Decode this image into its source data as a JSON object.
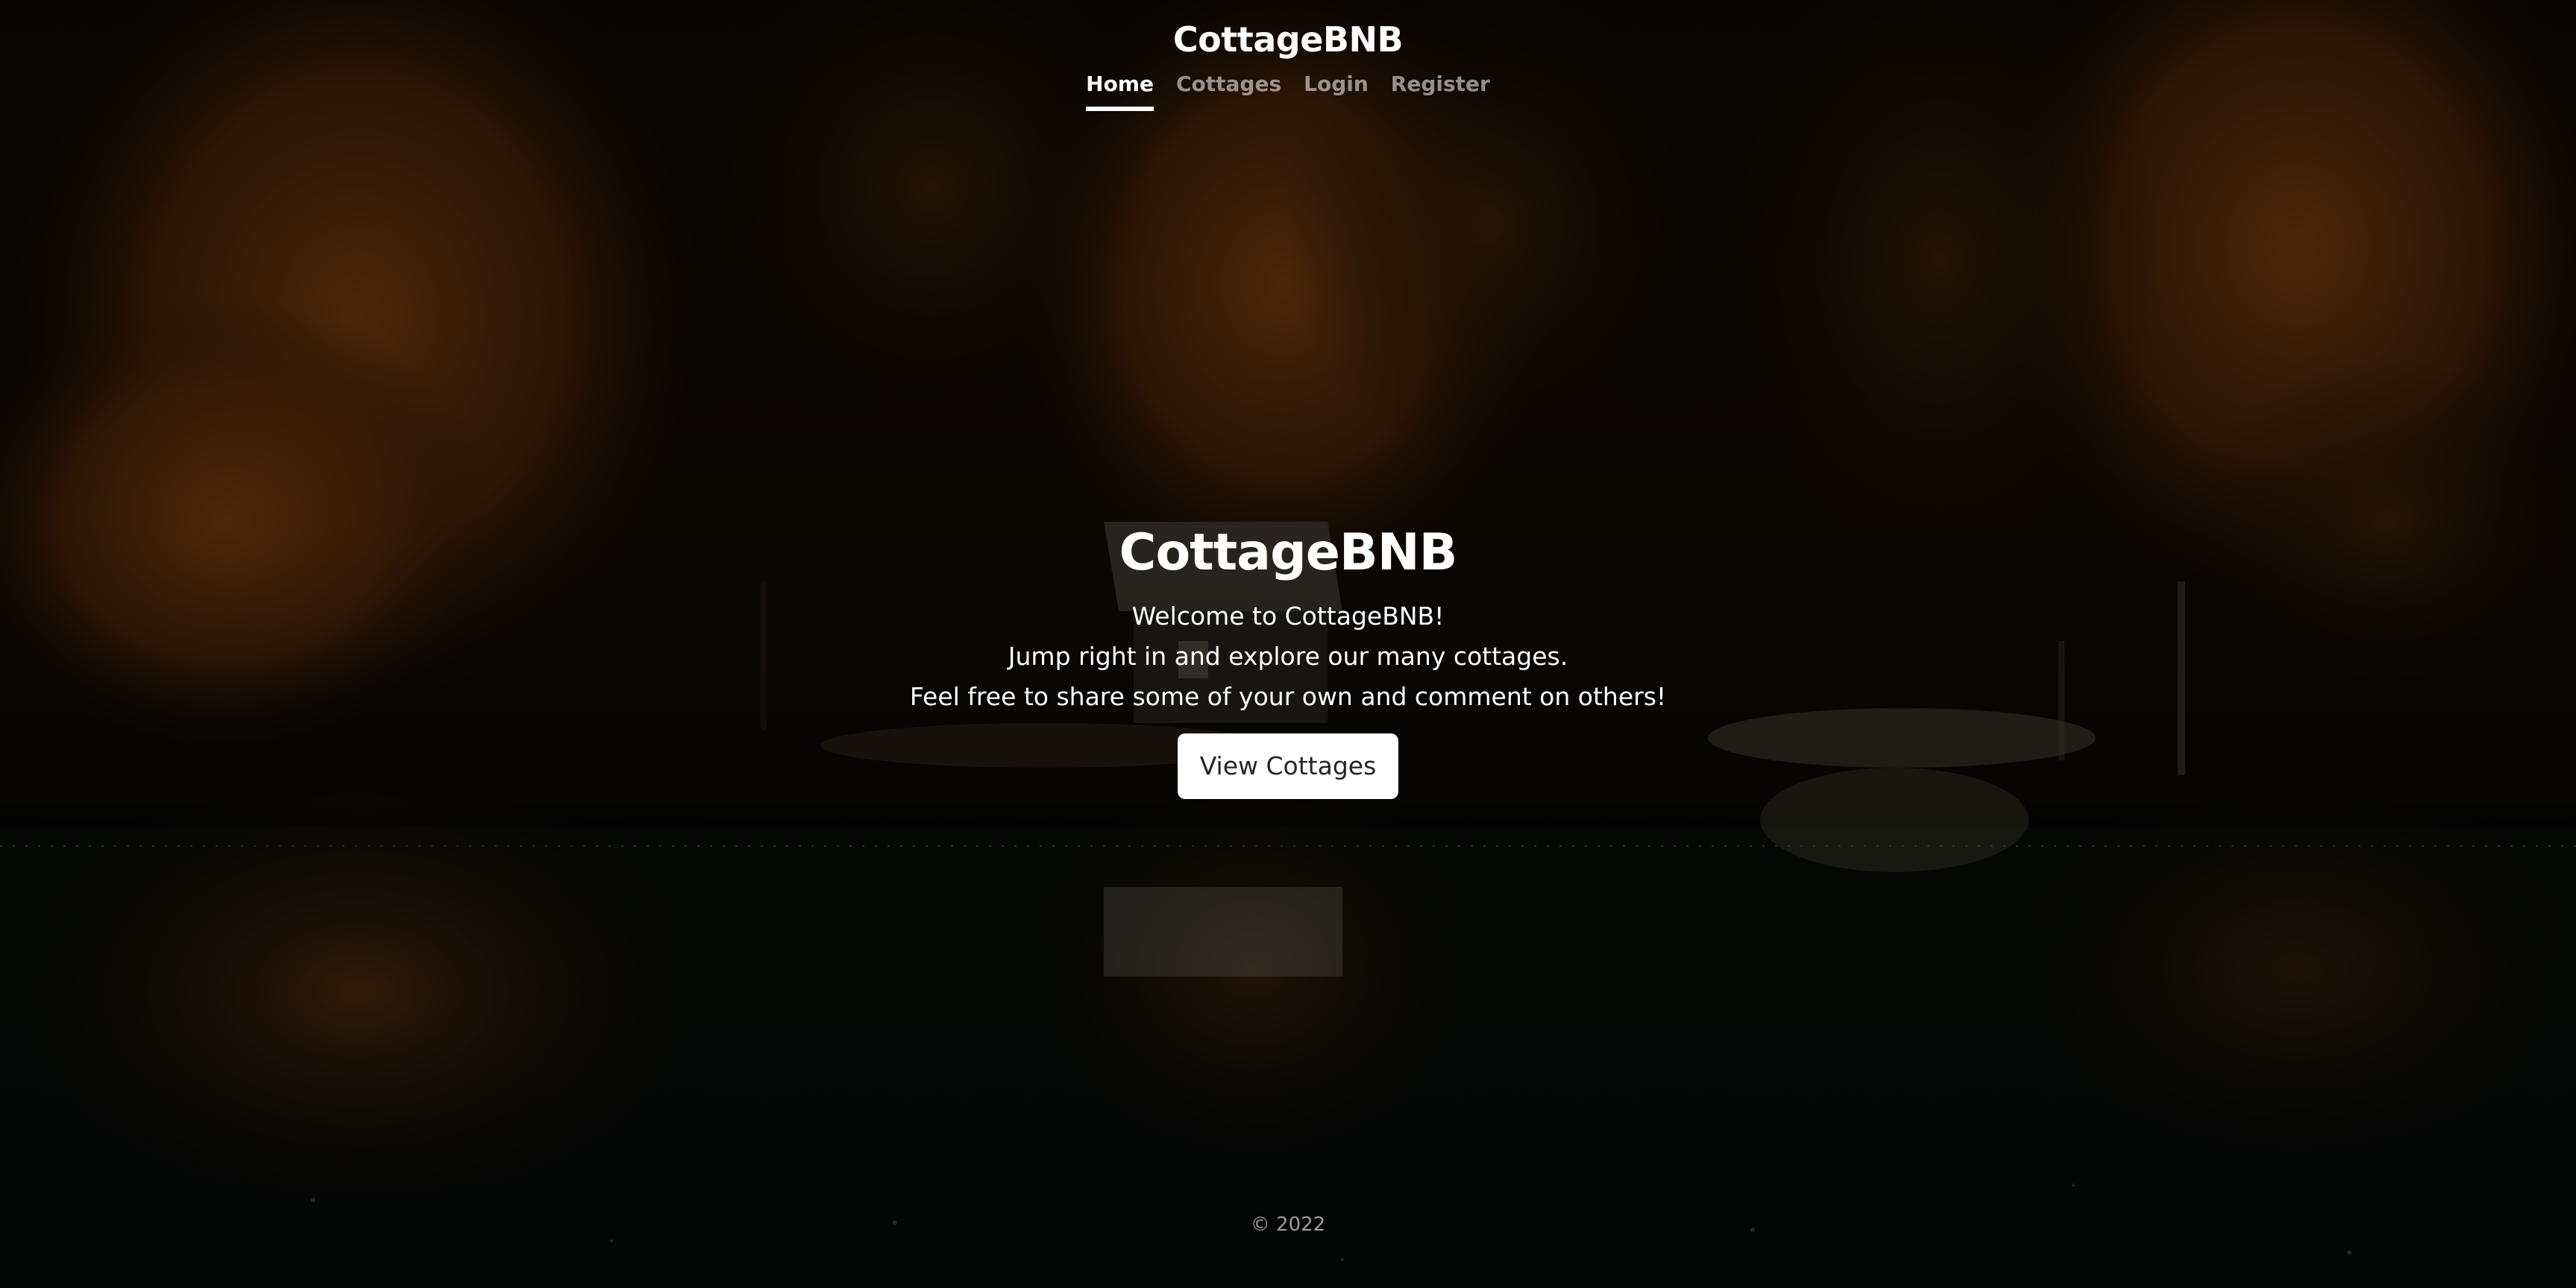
{
  "header": {
    "brand": "CottageBNB",
    "nav": [
      {
        "label": "Home",
        "active": true
      },
      {
        "label": "Cottages",
        "active": false
      },
      {
        "label": "Login",
        "active": false
      },
      {
        "label": "Register",
        "active": false
      }
    ]
  },
  "hero": {
    "title": "CottageBNB",
    "lines": [
      "Welcome to CottageBNB!",
      "Jump right in and explore our many cottages.",
      "Feel free to share some of your own and comment on others!"
    ],
    "button_label": "View Cottages"
  },
  "footer": {
    "text": "© 2022"
  },
  "colors": {
    "text": "#ffffff",
    "nav_inactive": "rgba(255,255,255,0.55)",
    "button_bg": "#ffffff",
    "button_text": "#212529"
  }
}
